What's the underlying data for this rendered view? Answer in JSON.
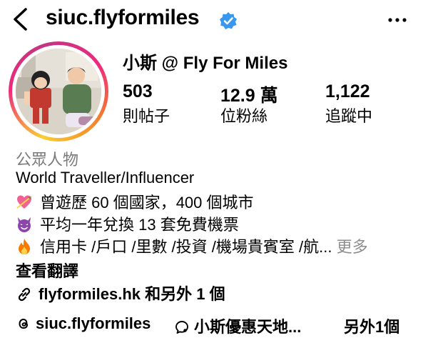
{
  "header": {
    "username": "siuc.flyformiles",
    "back_icon": "chevron-left-icon",
    "more_icon": "ellipsis-icon",
    "verified_icon": "verified-badge-icon",
    "verified_color": "#3897f0"
  },
  "profile": {
    "display_name": "小斯 @ Fly For Miles",
    "avatar_ring_colors": [
      "#f9ce34",
      "#ee2a7b",
      "#c13584"
    ],
    "stats": [
      {
        "value": "503",
        "label": "則帖子"
      },
      {
        "value": "12.9 萬",
        "label": "位粉絲"
      },
      {
        "value": "1,122",
        "label": "追蹤中"
      }
    ]
  },
  "bio": {
    "category": "公眾人物",
    "headline": "World Traveller/Influencer",
    "lines": [
      {
        "emoji": "heart-with-arrow-icon",
        "text": "曾遊歷 60 個國家，400 個城市"
      },
      {
        "emoji": "smiling-devil-icon",
        "text": "平均一年兌換 13 套免費機票"
      },
      {
        "emoji": "fire-icon",
        "text": "信用卡 /戶口 /里數 /投資 /機場貴賓室 /航..."
      }
    ],
    "more_label": "更多",
    "see_translation": "查看翻譯",
    "link_text": "flyformiles.hk 和另外 1 個",
    "link_icon": "link-icon"
  },
  "bottom": {
    "threads_handle": "siuc.flyformiles",
    "threads_icon": "threads-icon",
    "channel_name": "小斯優惠天地...",
    "channel_icon": "broadcast-channel-icon",
    "others_label": "另外1個"
  }
}
